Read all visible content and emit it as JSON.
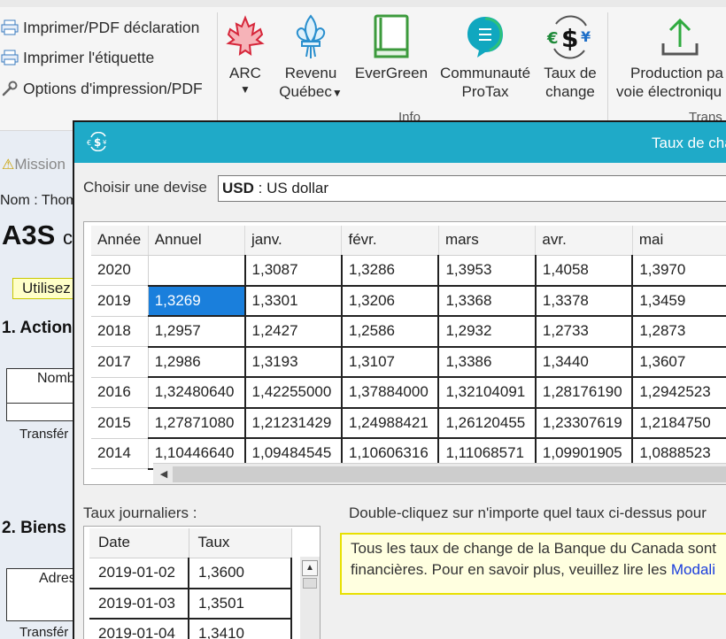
{
  "ribbon": {
    "print_items": [
      {
        "label": "Imprimer/PDF déclaration",
        "icon": "printer-icon"
      },
      {
        "label": "Imprimer l'étiquette",
        "icon": "printer-icon"
      },
      {
        "label": "Options d'impression/PDF",
        "icon": "wrench-icon"
      }
    ],
    "buttons": {
      "arc": {
        "label": "ARC",
        "icon": "maple-leaf-icon"
      },
      "revenu_quebec": {
        "line1": "Revenu",
        "line2": "Québec",
        "icon": "fleur-de-lis-icon"
      },
      "evergreen": {
        "label": "EverGreen",
        "icon": "book-icon"
      },
      "communaute": {
        "line1": "Communauté",
        "line2": "ProTax",
        "icon": "chat-bubble-icon"
      },
      "taux_change": {
        "line1": "Taux de",
        "line2": "change",
        "icon": "currency-exchange-icon"
      },
      "production": {
        "line1": "Production pa",
        "line2": "voie électroniqu",
        "icon": "upload-arrow-icon"
      }
    },
    "group_labels": {
      "info": "Info",
      "trans": "Trans"
    }
  },
  "background": {
    "mission": "Mission",
    "nom": "Nom : Thom",
    "a3s": "A3S",
    "a3s_suffix": "c",
    "utilisez": "Utilisez",
    "section1": "1. Action",
    "nomb": "Nomb",
    "transfer1": "Transfér",
    "section2": "2. Biens",
    "adres": "Adres",
    "transfer2": "Transfér"
  },
  "dialog": {
    "title": "Taux de cha",
    "currency_label": "Choisir une devise",
    "currency_code": "USD",
    "currency_name": " : US dollar",
    "rates_table": {
      "headers": [
        "Année",
        "Annuel",
        "janv.",
        "févr.",
        "mars",
        "avr.",
        "mai"
      ],
      "rows": [
        [
          "2020",
          "",
          "1,3087",
          "1,3286",
          "1,3953",
          "1,4058",
          "1,3970"
        ],
        [
          "2019",
          "1,3269",
          "1,3301",
          "1,3206",
          "1,3368",
          "1,3378",
          "1,3459"
        ],
        [
          "2018",
          "1,2957",
          "1,2427",
          "1,2586",
          "1,2932",
          "1,2733",
          "1,2873"
        ],
        [
          "2017",
          "1,2986",
          "1,3193",
          "1,3107",
          "1,3386",
          "1,3440",
          "1,3607"
        ],
        [
          "2016",
          "1,32480640",
          "1,42255000",
          "1,37884000",
          "1,32104091",
          "1,28176190",
          "1,2942523"
        ],
        [
          "2015",
          "1,27871080",
          "1,21231429",
          "1,24988421",
          "1,26120455",
          "1,23307619",
          "1,2184750"
        ],
        [
          "2014",
          "1,10446640",
          "1,09484545",
          "1,10606316",
          "1,11068571",
          "1,09901905",
          "1,0888523"
        ]
      ],
      "selected": {
        "row": 1,
        "col": 1
      }
    },
    "daily_label": "Taux journaliers :",
    "daily_table": {
      "headers": [
        "Date",
        "Taux"
      ],
      "rows": [
        [
          "2019-01-02",
          "1,3600"
        ],
        [
          "2019-01-03",
          "1,3501"
        ],
        [
          "2019-01-04",
          "1,3410"
        ]
      ]
    },
    "double_click_hint": "Double-cliquez sur n'importe quel taux ci-dessus pour",
    "notice": {
      "line1": "Tous les taux de change de la Banque du Canada sont",
      "line2": "financières. Pour en savoir plus, veuillez lire les ",
      "link": "Modali"
    }
  },
  "colors": {
    "titlebar": "#1faac8",
    "selection": "#1a7fdc",
    "notice_bg": "#ffffe0",
    "notice_border": "#e8e000",
    "link": "#1a3ddc"
  }
}
